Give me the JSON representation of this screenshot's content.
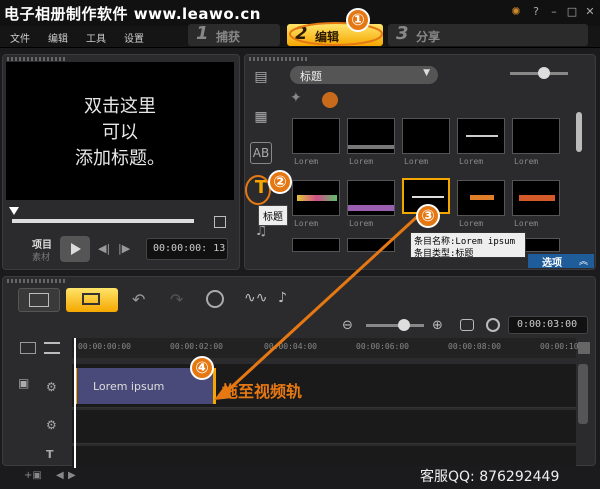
{
  "window": {
    "title": "电子相册制作软件 www.leawo.cn"
  },
  "menu": [
    "文件",
    "编辑",
    "工具",
    "设置"
  ],
  "steps": [
    {
      "num": "1",
      "label": "捕获"
    },
    {
      "num": "2",
      "label": "编辑"
    },
    {
      "num": "3",
      "label": "分享"
    }
  ],
  "preview": {
    "line1": "双击这里",
    "line2": "可以",
    "line3": "添加标题。",
    "mode_label": "项目",
    "mode_sub": "素材",
    "timecode": "00:00:00: 13"
  },
  "library": {
    "category": "标题",
    "tooltip": "标题",
    "options_label": "选项",
    "thumbs": [
      "Lorem",
      "Lorem",
      "Lorem",
      "Lorem",
      "Lorem",
      "Lorem",
      "Lorem",
      "Lorem",
      "Lorem",
      "Lorem"
    ],
    "info_name": "条目名称:Lorem ipsum",
    "info_type": "条目类型:标题"
  },
  "timeline": {
    "zoom_time": "0:00:03:00",
    "ticks": [
      "00:00:00:00",
      "00:00:02:00",
      "00:00:04:00",
      "00:00:06:00",
      "00:00:08:00",
      "00:00:10"
    ],
    "clip_text": "Lorem ipsum"
  },
  "annotations": {
    "c1": "①",
    "c2": "②",
    "c3": "③",
    "c4": "④",
    "drag_text": "拖至视频轨",
    "support": "客服QQ: 876292449"
  },
  "colors": {
    "accent": "#f5a700",
    "callout": "#e67813",
    "clip": "#4a4a7a"
  }
}
